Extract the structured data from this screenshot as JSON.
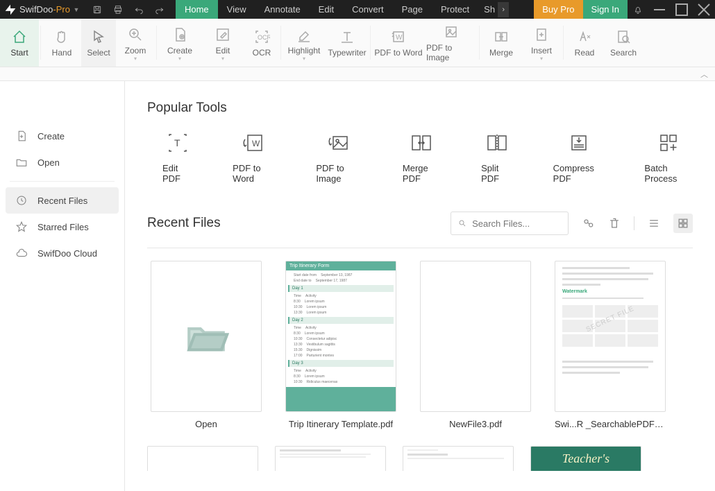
{
  "app": {
    "name": "SwifDoo",
    "suffix": "-Pro"
  },
  "titlebar_icons": [
    "save-icon",
    "print-icon",
    "undo-icon",
    "redo-icon"
  ],
  "menu": {
    "items": [
      "Home",
      "View",
      "Annotate",
      "Edit",
      "Convert",
      "Page",
      "Protect",
      "Sh"
    ],
    "active": 0
  },
  "auth": {
    "buy": "Buy Pro",
    "signin": "Sign In"
  },
  "ribbon": {
    "start": "Start",
    "hand": "Hand",
    "select": "Select",
    "zoom": "Zoom",
    "create": "Create",
    "edit": "Edit",
    "ocr": "OCR",
    "highlight": "Highlight",
    "typewriter": "Typewriter",
    "p2w": "PDF to Word",
    "p2i": "PDF to Image",
    "merge": "Merge",
    "insert": "Insert",
    "read": "Read",
    "search": "Search"
  },
  "sidebar": {
    "create": "Create",
    "open": "Open",
    "recent": "Recent Files",
    "starred": "Starred Files",
    "cloud": "SwifDoo Cloud"
  },
  "popular": {
    "title": "Popular Tools",
    "tools": [
      "Edit PDF",
      "PDF to Word",
      "PDF to Image",
      "Merge PDF",
      "Split PDF",
      "Compress PDF",
      "Batch Process"
    ]
  },
  "recent": {
    "title": "Recent Files",
    "search_placeholder": "Search Files...",
    "items": [
      {
        "name": "Open",
        "kind": "open"
      },
      {
        "name": "Trip Itinerary Template.pdf",
        "kind": "itinerary"
      },
      {
        "name": "NewFile3.pdf",
        "kind": "blank"
      },
      {
        "name": "Swi...R _SearchablePDF_.pdf",
        "kind": "watermark"
      }
    ],
    "row2_last": "Teacher's"
  },
  "thumb": {
    "itin_header": "Trip Itinerary Form",
    "day1": "Day 1",
    "day2": "Day 2",
    "day3": "Day 3",
    "wm_title": "Watermark",
    "wm_diag": "SECRET FILE"
  }
}
